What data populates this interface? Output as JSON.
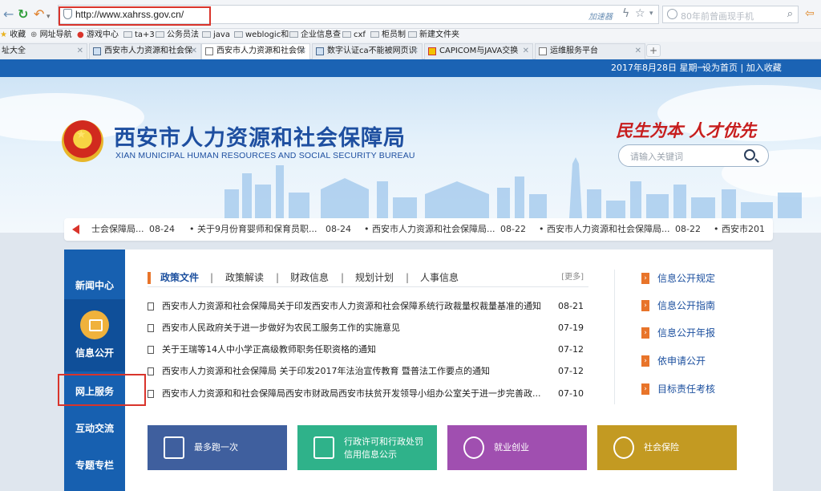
{
  "browser": {
    "url": "http://www.xahrss.gov.cn/",
    "accelerator_label": "加速器",
    "search_placeholder": "80年前曾画现手机",
    "bookmarks": [
      {
        "label": "收藏"
      },
      {
        "label": "网址导航"
      },
      {
        "label": "游戏中心"
      },
      {
        "label": "ta+3"
      },
      {
        "label": "公务员法"
      },
      {
        "label": "java"
      },
      {
        "label": "weblogic和"
      },
      {
        "label": "企业信息查"
      },
      {
        "label": "cxf"
      },
      {
        "label": "柜员制"
      },
      {
        "label": "新建文件夹"
      }
    ],
    "tabs": [
      {
        "label": "址大全"
      },
      {
        "label": "西安市人力资源和社会保"
      },
      {
        "label": "西安市人力资源和社会保"
      },
      {
        "label": "数字认证ca不能被网页识"
      },
      {
        "label": "CAPICOM与JAVA交换"
      },
      {
        "label": "运维服务平台"
      }
    ]
  },
  "site": {
    "topbar": {
      "date_text": "2017年8月28日 星期一",
      "links_text": "设为首页 | 加入收藏"
    },
    "title": "西安市人力资源和社会保障局",
    "subtitle": "XIAN MUNICIPAL HUMAN RESOURCES AND SOCIAL SECURITY BUREAU",
    "slogan": "民生为本 人才优先",
    "search_placeholder": "请输入关键词",
    "ticker": [
      {
        "title": "士会保障局...",
        "date": "08-24"
      },
      {
        "title": "关于9月份育婴师和保育员职...",
        "date": "08-24"
      },
      {
        "title": "西安市人力资源和社会保障局...",
        "date": "08-22"
      },
      {
        "title": "西安市人力资源和社会保障局...",
        "date": "08-22"
      },
      {
        "title": "西安市201",
        "date": ""
      }
    ],
    "sidebar": [
      {
        "label": "新闻中心"
      },
      {
        "label": "信息公开"
      },
      {
        "label": "网上服务"
      },
      {
        "label": "互动交流"
      },
      {
        "label": "专题专栏"
      }
    ],
    "news_tabs": [
      {
        "label": "政策文件"
      },
      {
        "label": "政策解读"
      },
      {
        "label": "财政信息"
      },
      {
        "label": "规划计划"
      },
      {
        "label": "人事信息"
      }
    ],
    "more_label": "[更多]",
    "news": [
      {
        "title": "西安市人力资源和社会保障局关于印发西安市人力资源和社会保障系统行政裁量权裁量基准的通知",
        "date": "08-21"
      },
      {
        "title": "西安市人民政府关于进一步做好为农民工服务工作的实施意见",
        "date": "07-19"
      },
      {
        "title": "关于王瑞等14人中小学正高级教师职务任职资格的通知",
        "date": "07-12"
      },
      {
        "title": "西安市人力资源和社会保障局 关于印发2017年法治宣传教育 暨普法工作要点的通知",
        "date": "07-12"
      },
      {
        "title": "西安市人力资源和和社会保障局西安市财政局西安市扶贫开发领导小组办公室关于进一步完善政...",
        "date": "07-10"
      }
    ],
    "quick_links": [
      {
        "label": "信息公开规定"
      },
      {
        "label": "信息公开指南"
      },
      {
        "label": "信息公开年报"
      },
      {
        "label": "依申请公开"
      },
      {
        "label": "目标责任考核"
      }
    ],
    "tiles": [
      {
        "line1": "最多跑一次",
        "line2": "",
        "color": "#3f5f9e"
      },
      {
        "line1": "行政许可和行政处罚",
        "line2": "信用信息公示",
        "color": "#2fb28a"
      },
      {
        "line1": "就业创业",
        "line2": "",
        "color": "#a04fb0"
      },
      {
        "line1": "社会保险",
        "line2": "",
        "color": "#c39a22"
      }
    ]
  }
}
